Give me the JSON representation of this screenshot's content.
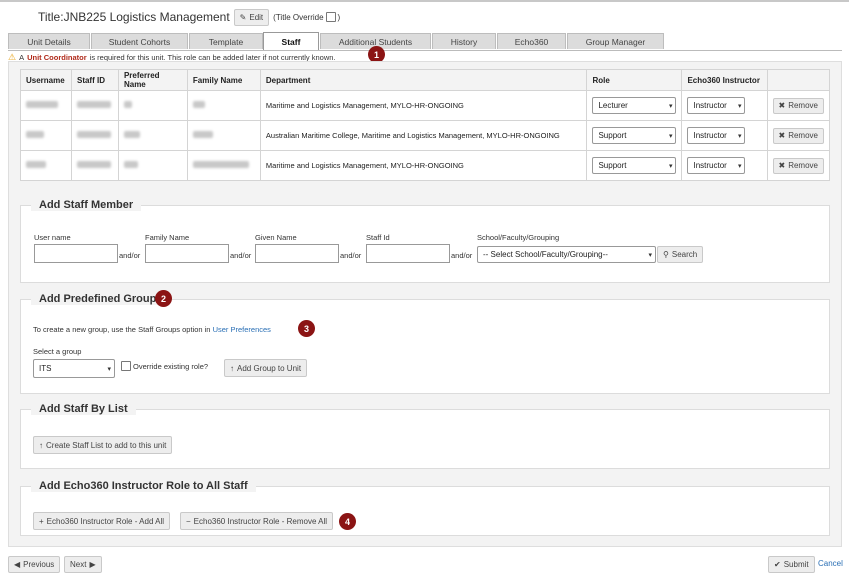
{
  "header": {
    "title_label": "Title:",
    "title_value": "JNB225 Logistics Management",
    "edit_label": "Edit",
    "title_override_open": "(Title Override",
    "title_override_close": ")"
  },
  "tabs": [
    {
      "label": "Unit Details"
    },
    {
      "label": "Student Cohorts"
    },
    {
      "label": "Template"
    },
    {
      "label": "Staff"
    },
    {
      "label": "Additional Students"
    },
    {
      "label": "History"
    },
    {
      "label": "Echo360"
    },
    {
      "label": "Group Manager"
    }
  ],
  "warning": {
    "prefix": "A",
    "emphasis": "Unit Coordinator",
    "suffix": "is required for this unit. This role can be added later if not currently known."
  },
  "badges": [
    "1",
    "2",
    "3",
    "4"
  ],
  "staff_table": {
    "headers": [
      "Username",
      "Staff ID",
      "Preferred Name",
      "Family Name",
      "Department",
      "Role",
      "Echo360 Instructor",
      ""
    ],
    "rows": [
      {
        "username": "",
        "staff_id": "",
        "preferred_name": "",
        "family_name": "",
        "department": "Maritime and Logistics Management, MYLO-HR-ONGOING",
        "role": "Lecturer",
        "echo": "Instructor"
      },
      {
        "username": "",
        "staff_id": "",
        "preferred_name": "",
        "family_name": "",
        "department": "Australian Maritime College, Maritime and Logistics Management, MYLO-HR-ONGOING",
        "role": "Support",
        "echo": "Instructor"
      },
      {
        "username": "",
        "staff_id": "",
        "preferred_name": "",
        "family_name": "",
        "department": "Maritime and Logistics Management, MYLO-HR-ONGOING",
        "role": "Support",
        "echo": "Instructor"
      }
    ],
    "remove_label": "Remove"
  },
  "add_staff": {
    "title": "Add Staff Member",
    "labels": [
      "User name",
      "Family Name",
      "Given Name",
      "Staff Id",
      "School/Faculty/Grouping"
    ],
    "andor": "and/or",
    "school_select": "-- Select School/Faculty/Grouping--",
    "search_label": "Search"
  },
  "predefined": {
    "title": "Add Predefined Group",
    "info_text": "To create a new group, use the Staff Groups option in",
    "info_link": "User Preferences",
    "select_label": "Select a group",
    "group_value": "ITS",
    "override_label": "Override existing role?",
    "add_button": "Add Group to Unit"
  },
  "by_list": {
    "title": "Add Staff By List",
    "button": "Create Staff List to add to this unit"
  },
  "echo_role": {
    "title": "Add Echo360 Instructor Role to All Staff",
    "add_all": "Echo360 Instructor Role - Add All",
    "remove_all": "Echo360 Instructor Role - Remove All"
  },
  "footer": {
    "previous": "Previous",
    "next": "Next",
    "submit": "Submit",
    "cancel": "Cancel"
  }
}
